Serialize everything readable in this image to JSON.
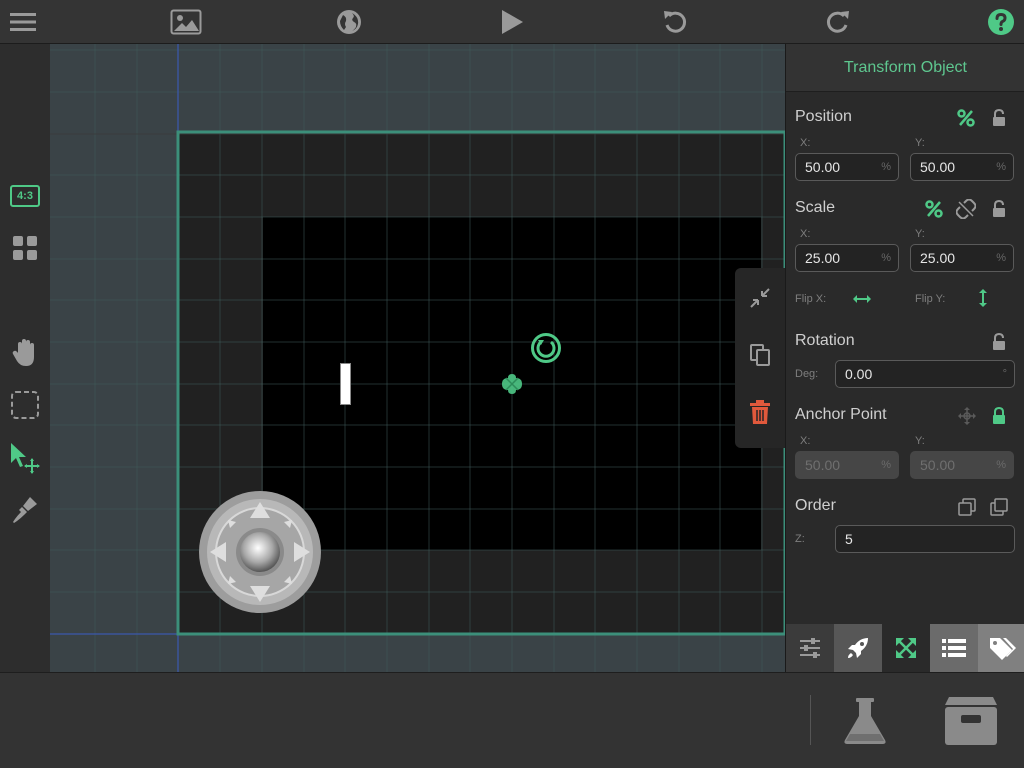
{
  "topbar": {
    "icons": [
      "menu-icon",
      "image-icon",
      "globe-icon",
      "play-icon",
      "undo-icon",
      "redo-icon",
      "help-icon"
    ]
  },
  "leftbar": {
    "aspect_label": "4:3",
    "icons": [
      "aspect-ratio-icon",
      "grid-icon",
      "hand-icon",
      "selection-icon",
      "move-select-icon",
      "brush-icon"
    ]
  },
  "colors": {
    "accent": "#4fc987",
    "danger": "#e0593c",
    "panel_bg": "#2a2a2a",
    "canvas_bg": "#3a4347",
    "scene_bg": "#000000"
  },
  "object_tools": {
    "icons": [
      "shrink-icon",
      "duplicate-icon",
      "trash-icon"
    ]
  },
  "panel": {
    "title": "Transform Object",
    "position": {
      "title": "Position",
      "x_label": "X:",
      "x_value": "50.00",
      "x_unit": "%",
      "y_label": "Y:",
      "y_value": "50.00",
      "y_unit": "%"
    },
    "scale": {
      "title": "Scale",
      "x_label": "X:",
      "x_value": "25.00",
      "x_unit": "%",
      "y_label": "Y:",
      "y_value": "25.00",
      "y_unit": "%",
      "flip_x_label": "Flip X:",
      "flip_y_label": "Flip Y:"
    },
    "rotation": {
      "title": "Rotation",
      "deg_label": "Deg:",
      "value": "0.00",
      "unit": "°"
    },
    "anchor": {
      "title": "Anchor Point",
      "x_label": "X:",
      "x_value": "50.00",
      "x_unit": "%",
      "y_label": "Y:",
      "y_value": "50.00",
      "y_unit": "%"
    },
    "order": {
      "title": "Order",
      "z_label": "Z:",
      "value": "5"
    },
    "tabs": [
      "properties-tab",
      "behaviors-tab",
      "transform-tab",
      "list-tab",
      "tags-tab"
    ],
    "active_tab": "transform-tab"
  },
  "bottombar": {
    "icons": [
      "flask-icon",
      "storage-box-icon"
    ]
  }
}
